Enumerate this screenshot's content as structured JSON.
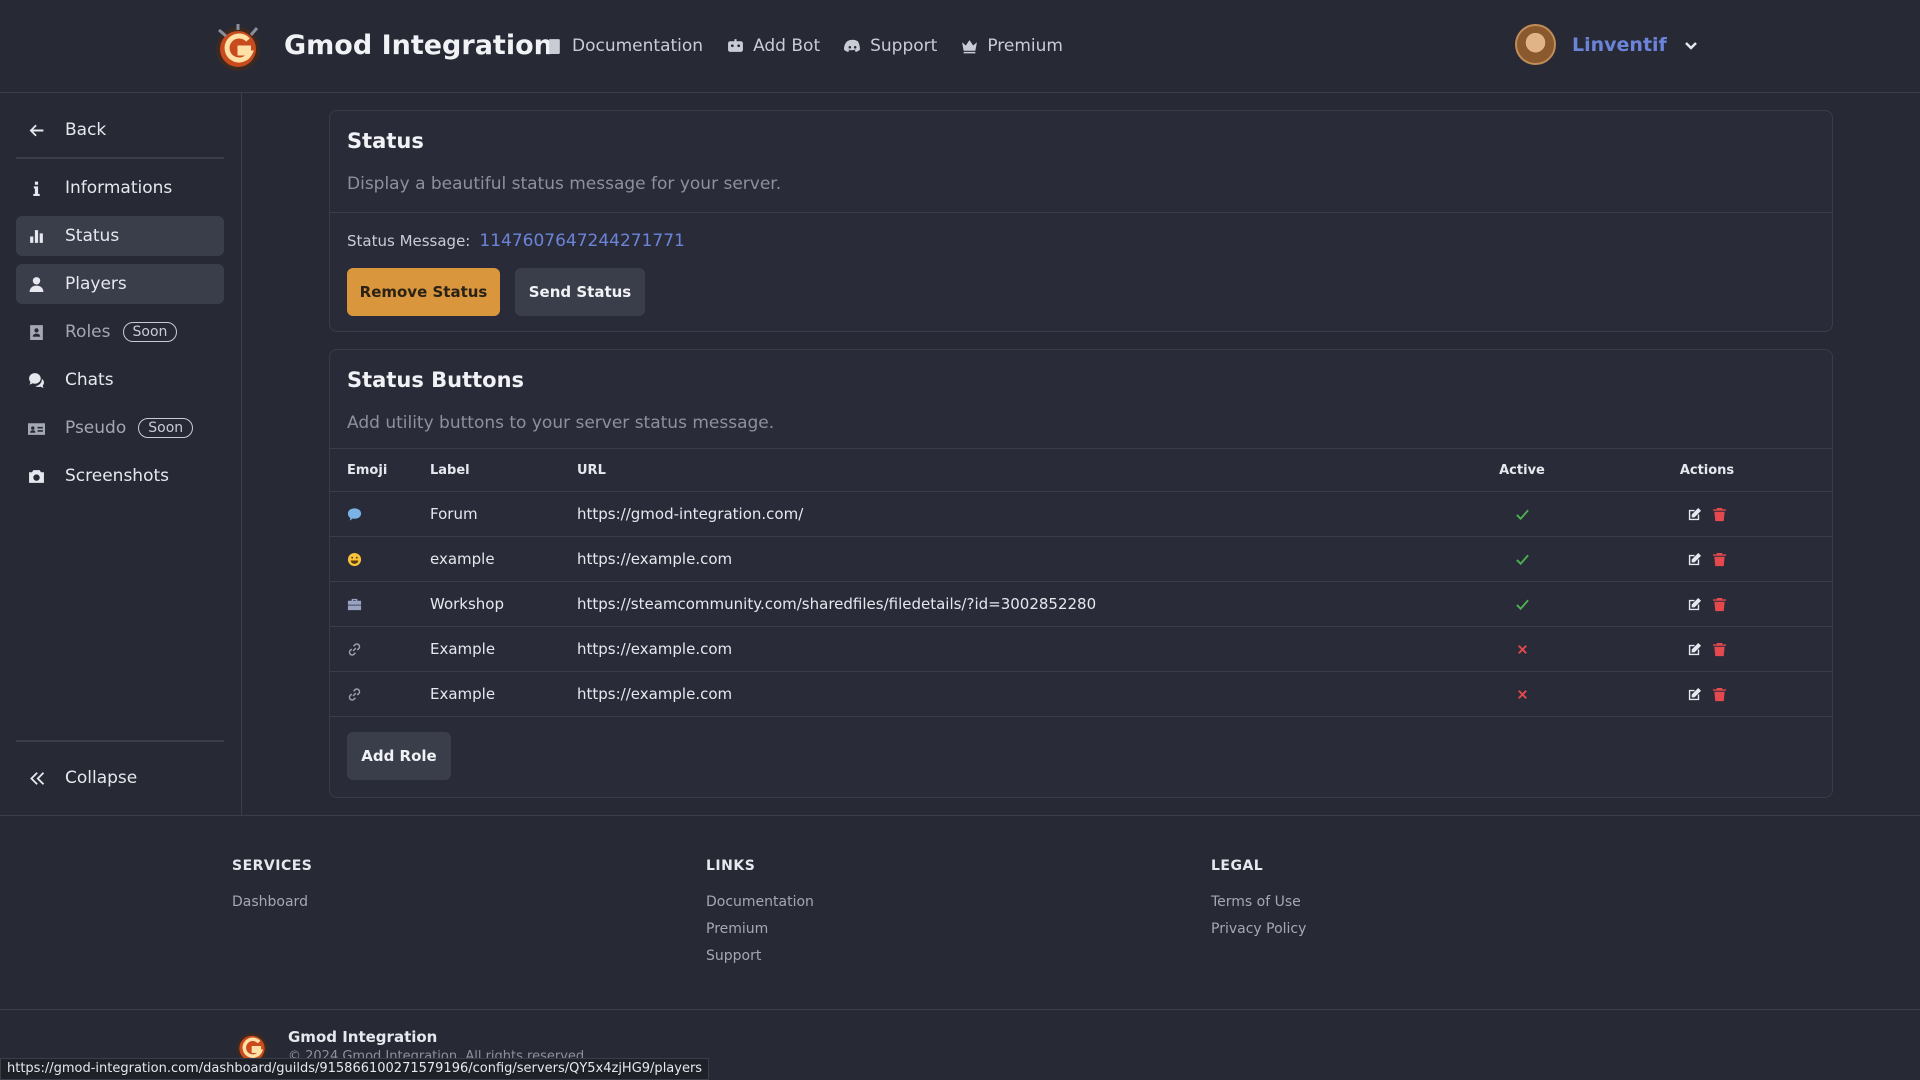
{
  "header": {
    "brand": "Gmod Integration",
    "nav": [
      {
        "label": "Documentation",
        "icon": "book-icon"
      },
      {
        "label": "Add Bot",
        "icon": "robot-icon"
      },
      {
        "label": "Support",
        "icon": "discord-icon"
      },
      {
        "label": "Premium",
        "icon": "crown-icon"
      }
    ],
    "user": {
      "name": "Linventif"
    }
  },
  "sidebar": {
    "back": "Back",
    "items": [
      {
        "label": "Informations",
        "icon": "info-icon"
      },
      {
        "label": "Status",
        "icon": "bar-chart-icon",
        "active": true
      },
      {
        "label": "Players",
        "icon": "user-icon",
        "active": true
      },
      {
        "label": "Roles",
        "icon": "id-badge-icon",
        "badge": "Soon"
      },
      {
        "label": "Chats",
        "icon": "chat-icon"
      },
      {
        "label": "Pseudo",
        "icon": "id-card-icon",
        "badge": "Soon"
      },
      {
        "label": "Screenshots",
        "icon": "camera-icon"
      }
    ],
    "collapse": "Collapse"
  },
  "status_card": {
    "title": "Status",
    "description": "Display a beautiful status message for your server.",
    "message_label": "Status Message:",
    "message_value": "1147607647244271771",
    "remove_label": "Remove Status",
    "send_label": "Send Status"
  },
  "buttons_card": {
    "title": "Status Buttons",
    "description": "Add utility buttons to your server status message.",
    "columns": {
      "emoji": "Emoji",
      "label": "Label",
      "url": "URL",
      "active": "Active",
      "actions": "Actions"
    },
    "rows": [
      {
        "emoji": "speech-balloon-emoji",
        "label": "Forum",
        "url": "https://gmod-integration.com/",
        "active": true
      },
      {
        "emoji": "grinning-emoji",
        "label": "example",
        "url": "https://example.com",
        "active": true
      },
      {
        "emoji": "toolbox-emoji",
        "label": "Workshop",
        "url": "https://steamcommunity.com/sharedfiles/filedetails/?id=3002852280",
        "active": true
      },
      {
        "emoji": "link-emoji",
        "label": "Example",
        "url": "https://example.com",
        "active": false
      },
      {
        "emoji": "link-emoji",
        "label": "Example",
        "url": "https://example.com",
        "active": false
      }
    ],
    "add_label": "Add Role"
  },
  "footer": {
    "services": {
      "title": "SERVICES",
      "links": [
        "Dashboard"
      ]
    },
    "links": {
      "title": "LINKS",
      "links": [
        "Documentation",
        "Premium",
        "Support"
      ]
    },
    "legal": {
      "title": "LEGAL",
      "links": [
        "Terms of Use",
        "Privacy Policy"
      ]
    },
    "brand": "Gmod Integration",
    "copyright": "© 2024 Gmod Integration. All rights reserved."
  },
  "status_bar_url": "https://gmod-integration.com/dashboard/guilds/915866100271579196/config/servers/QY5x4zjHG9/players",
  "colors": {
    "accent": "#6c84d8",
    "orange": "#d9963d",
    "check": "#4caf50",
    "cross": "#e5484d",
    "delete": "#e5484d"
  }
}
